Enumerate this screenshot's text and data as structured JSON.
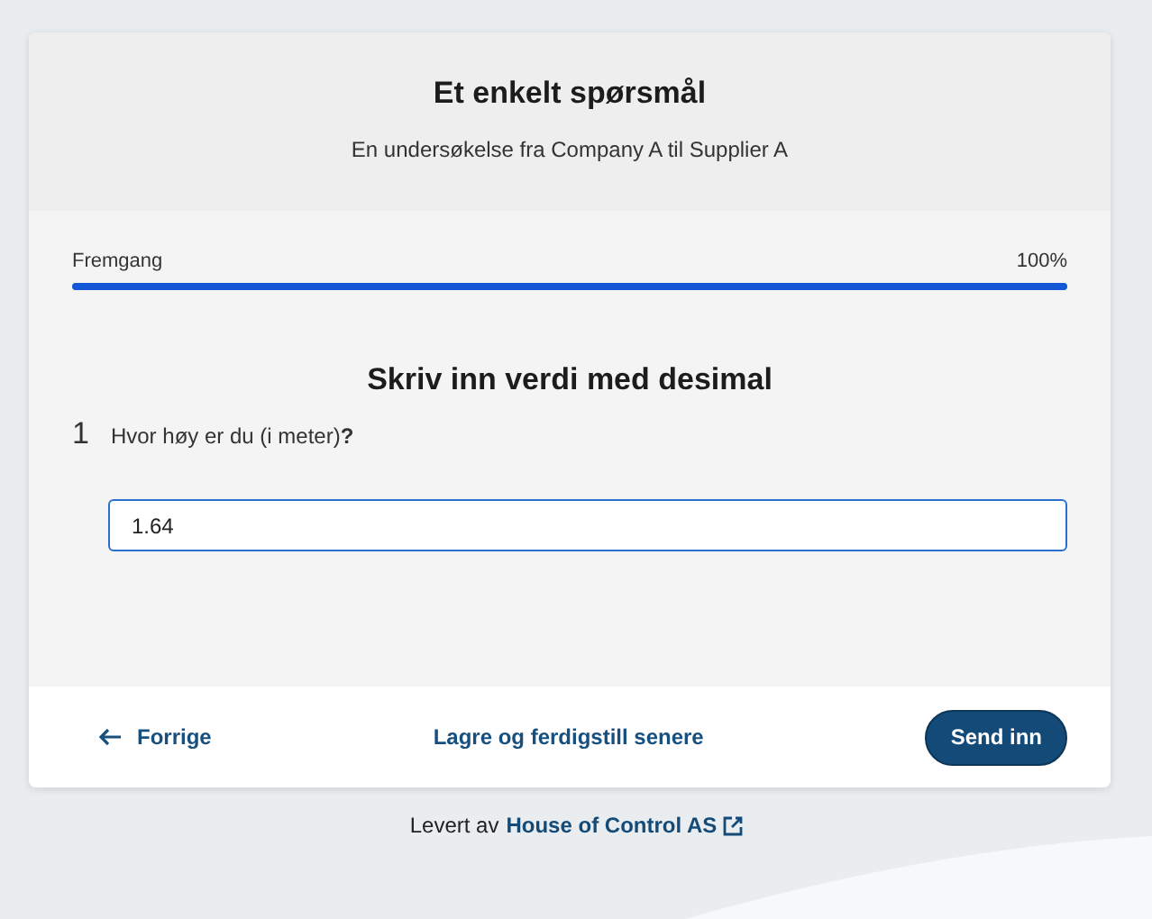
{
  "header": {
    "title": "Et enkelt spørsmål",
    "subtitle": "En undersøkelse fra Company A til Supplier A"
  },
  "progress": {
    "label": "Fremgang",
    "reading": "100%",
    "level": 1
  },
  "section_title": "Skriv inn verdi med desimal",
  "questions": [
    {
      "number": "1",
      "text": "Hvor høy er du (i meter)**?**",
      "value": "1.64"
    }
  ],
  "footer": {
    "previous": "Forrige",
    "save_later": "Lagre og ferdigstill senere",
    "submit": "Send inn"
  },
  "credit": {
    "prefix": "Levert av",
    "link": "House of Control AS"
  }
}
